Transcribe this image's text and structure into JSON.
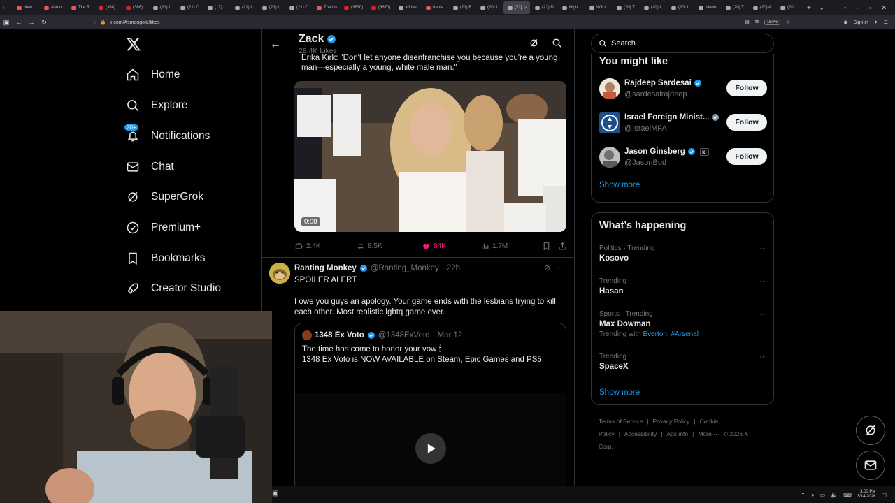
{
  "browser": {
    "tabs": [
      {
        "label": "New",
        "color": "#e55"
      },
      {
        "label": "Asmo",
        "color": "#e55"
      },
      {
        "label": "The R",
        "color": "#e55"
      },
      {
        "label": "(368)",
        "color": "#d22"
      },
      {
        "label": "(368)",
        "color": "#d22"
      },
      {
        "label": "(21) I",
        "color": "#aaa"
      },
      {
        "label": "(21) O",
        "color": "#aaa"
      },
      {
        "label": "(17) I",
        "color": "#aaa"
      },
      {
        "label": "(21) I",
        "color": "#aaa"
      },
      {
        "label": "(21) I",
        "color": "#aaa"
      },
      {
        "label": "(21) C",
        "color": "#aaa"
      },
      {
        "label": "The Lo",
        "color": "#e55"
      },
      {
        "label": "(3670)",
        "color": "#d22"
      },
      {
        "label": "(3670)",
        "color": "#d22"
      },
      {
        "label": "x/Live",
        "color": "#aaa"
      },
      {
        "label": "Irania",
        "color": "#e55"
      },
      {
        "label": "(21) E",
        "color": "#aaa"
      },
      {
        "label": "(20) I",
        "color": "#aaa"
      },
      {
        "label": "(21)",
        "color": "#aaa"
      },
      {
        "label": "(21) D",
        "color": "#aaa"
      },
      {
        "label": "High",
        "color": "#aaa"
      },
      {
        "label": "Will I",
        "color": "#aaa"
      },
      {
        "label": "(20) T",
        "color": "#aaa"
      },
      {
        "label": "(20) I",
        "color": "#aaa"
      },
      {
        "label": "(20) I",
        "color": "#aaa"
      },
      {
        "label": "Mario",
        "color": "#aaa"
      },
      {
        "label": "(20) T",
        "color": "#aaa"
      },
      {
        "label": "(20) A",
        "color": "#aaa"
      },
      {
        "label": "(20",
        "color": "#aaa"
      }
    ],
    "active_tab_index": 18,
    "url": "x.com/Asmongold/likes",
    "zoom": "150%",
    "sign_in": "Sign in"
  },
  "nav": {
    "items": [
      {
        "label": "Home",
        "icon": "home-icon"
      },
      {
        "label": "Explore",
        "icon": "search-icon"
      },
      {
        "label": "Notifications",
        "icon": "bell-icon",
        "badge": "20+"
      },
      {
        "label": "Chat",
        "icon": "mail-icon"
      },
      {
        "label": "SuperGrok",
        "icon": "grok-icon"
      },
      {
        "label": "Premium+",
        "icon": "verified-icon"
      },
      {
        "label": "Bookmarks",
        "icon": "bookmark-icon"
      },
      {
        "label": "Creator Studio",
        "icon": "rocket-icon"
      }
    ]
  },
  "profile": {
    "name": "Zack",
    "likes_count": "28.4K Likes"
  },
  "tweet1": {
    "text": "Erika Kirk: \"Don't let anyone disenfranchise you because you're a young man—especially a young, white male man.\"",
    "video_time": "0:08",
    "replies": "2.4K",
    "reposts": "8.5K",
    "likes": "84K",
    "views": "1.7M",
    "accent_like": "#f91880"
  },
  "tweet2": {
    "name": "Ranting Monkey",
    "handle": "@Ranting_Monkey",
    "time": "· 22h",
    "spoiler": "SPOILER ALERT",
    "body": "I owe you guys an apology. Your game ends with the lesbians trying to kill each other. Most realistic lgbtq game ever.",
    "quote": {
      "name": "1348 Ex Voto",
      "handle": "@1348ExVoto",
      "time": "· Mar 12",
      "line1": "The time has come to honor your vow 🕯",
      "line2": "1348 Ex Voto is NOW AVAILABLE on Steam, Epic Games and PS5."
    }
  },
  "search": {
    "placeholder": "Search"
  },
  "you_might_like": {
    "title": "You might like",
    "people": [
      {
        "name": "Rajdeep Sardesai",
        "handle": "@sardesairajdeep",
        "follow": "Follow",
        "verified_color": "#1d9bf0"
      },
      {
        "name": "Israel Foreign Minist...",
        "handle": "@IsraelMFA",
        "follow": "Follow",
        "verified_color": "#829aab"
      },
      {
        "name": "Jason Ginsberg",
        "handle": "@JasonBud",
        "follow": "Follow",
        "verified_color": "#1d9bf0",
        "extra": "xI"
      }
    ],
    "show_more": "Show more"
  },
  "happening": {
    "title": "What’s happening",
    "trends": [
      {
        "category": "Politics · Trending",
        "name": "Kosovo"
      },
      {
        "category": "Trending",
        "name": "Hasan"
      },
      {
        "category": "Sports · Trending",
        "name": "Max Dowman",
        "with_prefix": "Trending with",
        "with_links": "Everton, #Arsenal"
      },
      {
        "category": "Trending",
        "name": "SpaceX"
      }
    ],
    "show_more": "Show more"
  },
  "footer": {
    "links": [
      "Terms of Service",
      "|",
      "Privacy Policy",
      "|",
      "Cookie Policy",
      "|",
      "Accessibility",
      "|",
      "Ads info",
      "|",
      "More ···",
      "© 2026 X Corp."
    ]
  },
  "taskbar": {
    "time": "3:00 PM",
    "date": "3/14/2026"
  }
}
